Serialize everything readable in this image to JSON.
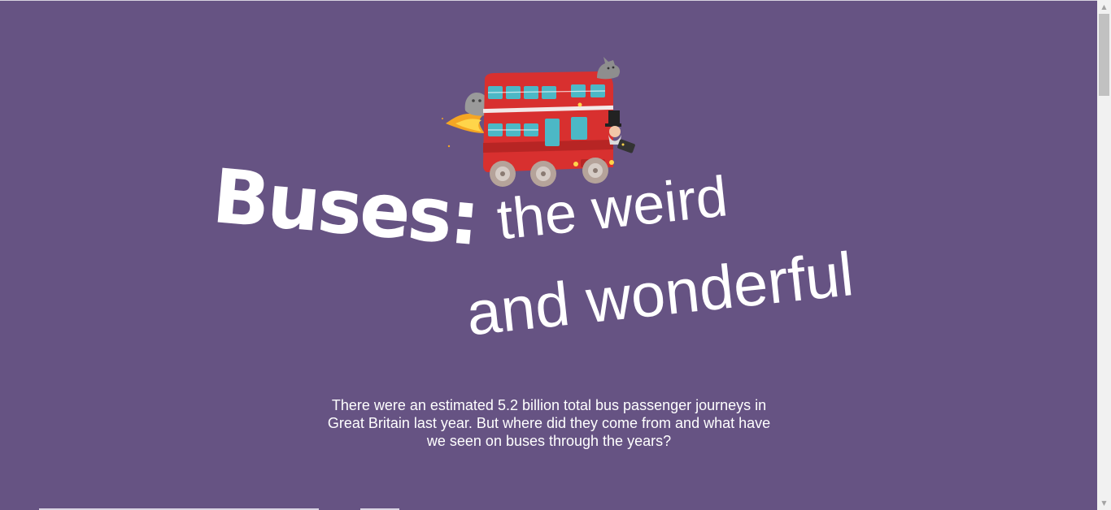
{
  "hero": {
    "title_bold": "Buses:",
    "title_line1": "the weird",
    "title_line2": "and wonderful",
    "intro": "There were an estimated 5.2 billion total bus passenger journeys in Great Britain last year. But where did they come from and what have we seen on buses through the years?"
  },
  "illustration": {
    "name": "double-decker-bus-illustration",
    "icons": [
      "ghost-icon",
      "cat-icon",
      "flame-icon",
      "wizard-icon"
    ]
  },
  "colors": {
    "background": "#665383",
    "bus_red": "#d8302f",
    "window_teal": "#4cb8c6",
    "text": "#ffffff"
  },
  "scrollbar": {
    "up_glyph": "▲",
    "down_glyph": "▼"
  }
}
